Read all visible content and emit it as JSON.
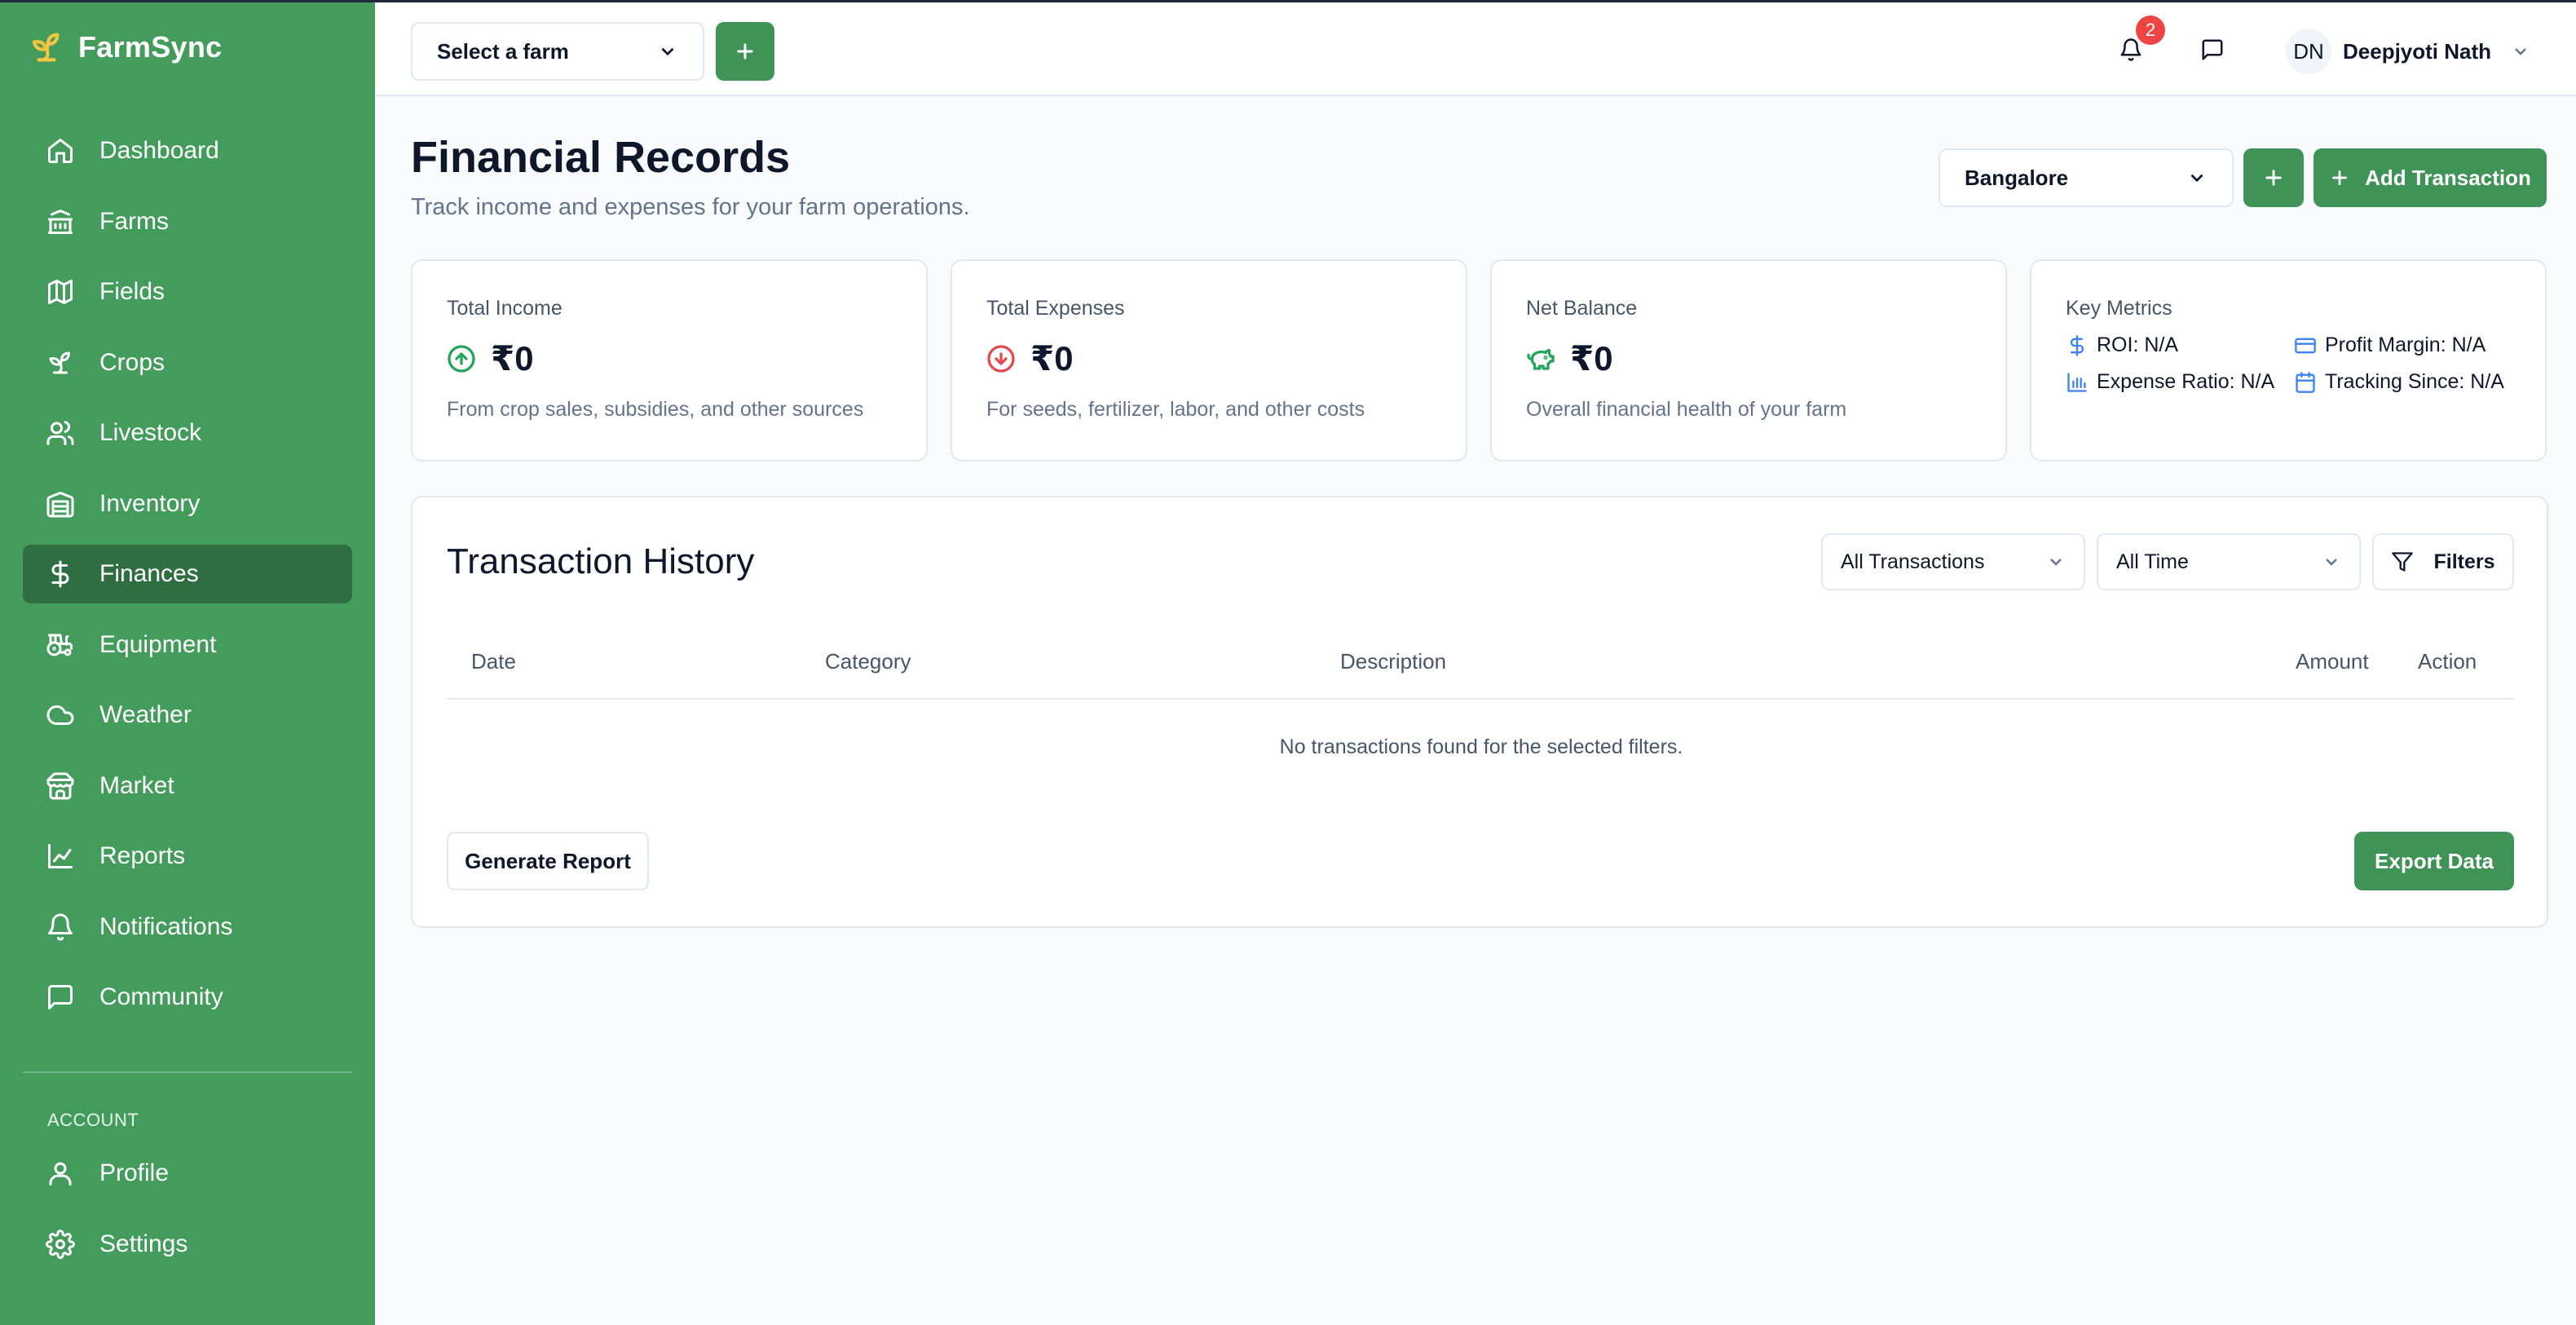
{
  "app": {
    "name": "FarmSync"
  },
  "sidebar": {
    "items": [
      {
        "label": "Dashboard",
        "icon": "home-icon"
      },
      {
        "label": "Farms",
        "icon": "bank-icon"
      },
      {
        "label": "Fields",
        "icon": "map-icon"
      },
      {
        "label": "Crops",
        "icon": "sprout-icon"
      },
      {
        "label": "Livestock",
        "icon": "users-icon"
      },
      {
        "label": "Inventory",
        "icon": "warehouse-icon"
      },
      {
        "label": "Finances",
        "icon": "dollar-icon",
        "active": true
      },
      {
        "label": "Equipment",
        "icon": "tractor-icon"
      },
      {
        "label": "Weather",
        "icon": "cloud-icon"
      },
      {
        "label": "Market",
        "icon": "store-icon"
      },
      {
        "label": "Reports",
        "icon": "line-chart-icon"
      },
      {
        "label": "Notifications",
        "icon": "bell-icon"
      },
      {
        "label": "Community",
        "icon": "message-icon"
      }
    ],
    "account_label": "ACCOUNT",
    "account_items": [
      {
        "label": "Profile",
        "icon": "user-icon"
      },
      {
        "label": "Settings",
        "icon": "gear-icon"
      }
    ]
  },
  "topbar": {
    "farm_select": "Select a farm",
    "notification_count": "2",
    "user_initials": "DN",
    "user_name": "Deepjyoti Nath"
  },
  "header": {
    "title": "Financial Records",
    "subtitle": "Track income and expenses for your farm operations.",
    "location": "Bangalore",
    "add_transaction": "Add Transaction"
  },
  "stats": {
    "income": {
      "label": "Total Income",
      "value": "₹0",
      "desc": "From crop sales, subsidies, and other sources"
    },
    "expenses": {
      "label": "Total Expenses",
      "value": "₹0",
      "desc": "For seeds, fertilizer, labor, and other costs"
    },
    "balance": {
      "label": "Net Balance",
      "value": "₹0",
      "desc": "Overall financial health of your farm"
    },
    "metrics": {
      "label": "Key Metrics",
      "roi": "ROI: N/A",
      "profit_margin": "Profit Margin: N/A",
      "expense_ratio": "Expense Ratio: N/A",
      "tracking_since": "Tracking Since: N/A"
    }
  },
  "history": {
    "title": "Transaction History",
    "type_filter": "All Transactions",
    "time_filter": "All Time",
    "filters_label": "Filters",
    "columns": [
      "Date",
      "Category",
      "Description",
      "Amount",
      "Action"
    ],
    "empty_text": "No transactions found for the selected filters.",
    "generate_report": "Generate Report",
    "export": "Export Data"
  },
  "colors": {
    "sidebar": "#449c5c",
    "sidebar_active": "#2f6e41",
    "accent": "#3f9356",
    "income": "#22a55a",
    "expense": "#e5484d",
    "metric_icon": "#3b82f6",
    "badge": "#ef4444"
  }
}
